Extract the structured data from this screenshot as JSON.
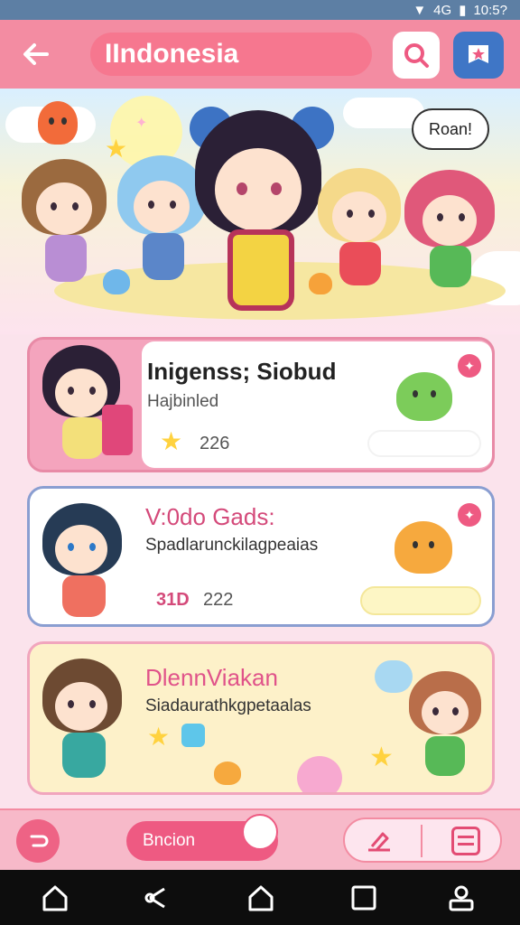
{
  "status_bar": {
    "signal": "4G",
    "time": "10:5?"
  },
  "header": {
    "title": "IIndonesia"
  },
  "hero": {
    "speech_bubble": "Roan!"
  },
  "cards": [
    {
      "title": "Inigenss; Siobud",
      "subtitle": "Hajbinled",
      "count": "226",
      "count_prefix": "",
      "title_color": "#222222"
    },
    {
      "title": "V:0do Gads:",
      "subtitle": "Spadlarunckilagpeaias",
      "count": "222",
      "count_prefix": "31D",
      "title_color": "#d44a7a"
    },
    {
      "title": "DlennViakan",
      "subtitle": "Siadaurathkgpetaalas",
      "count": "",
      "count_prefix": "",
      "title_color": "#e0538a"
    }
  ],
  "bottom_bar": {
    "pill_label": "Bncion"
  },
  "colors": {
    "accent": "#f38ca2",
    "primary_pink": "#ee5a82",
    "blue": "#3f76c6"
  }
}
